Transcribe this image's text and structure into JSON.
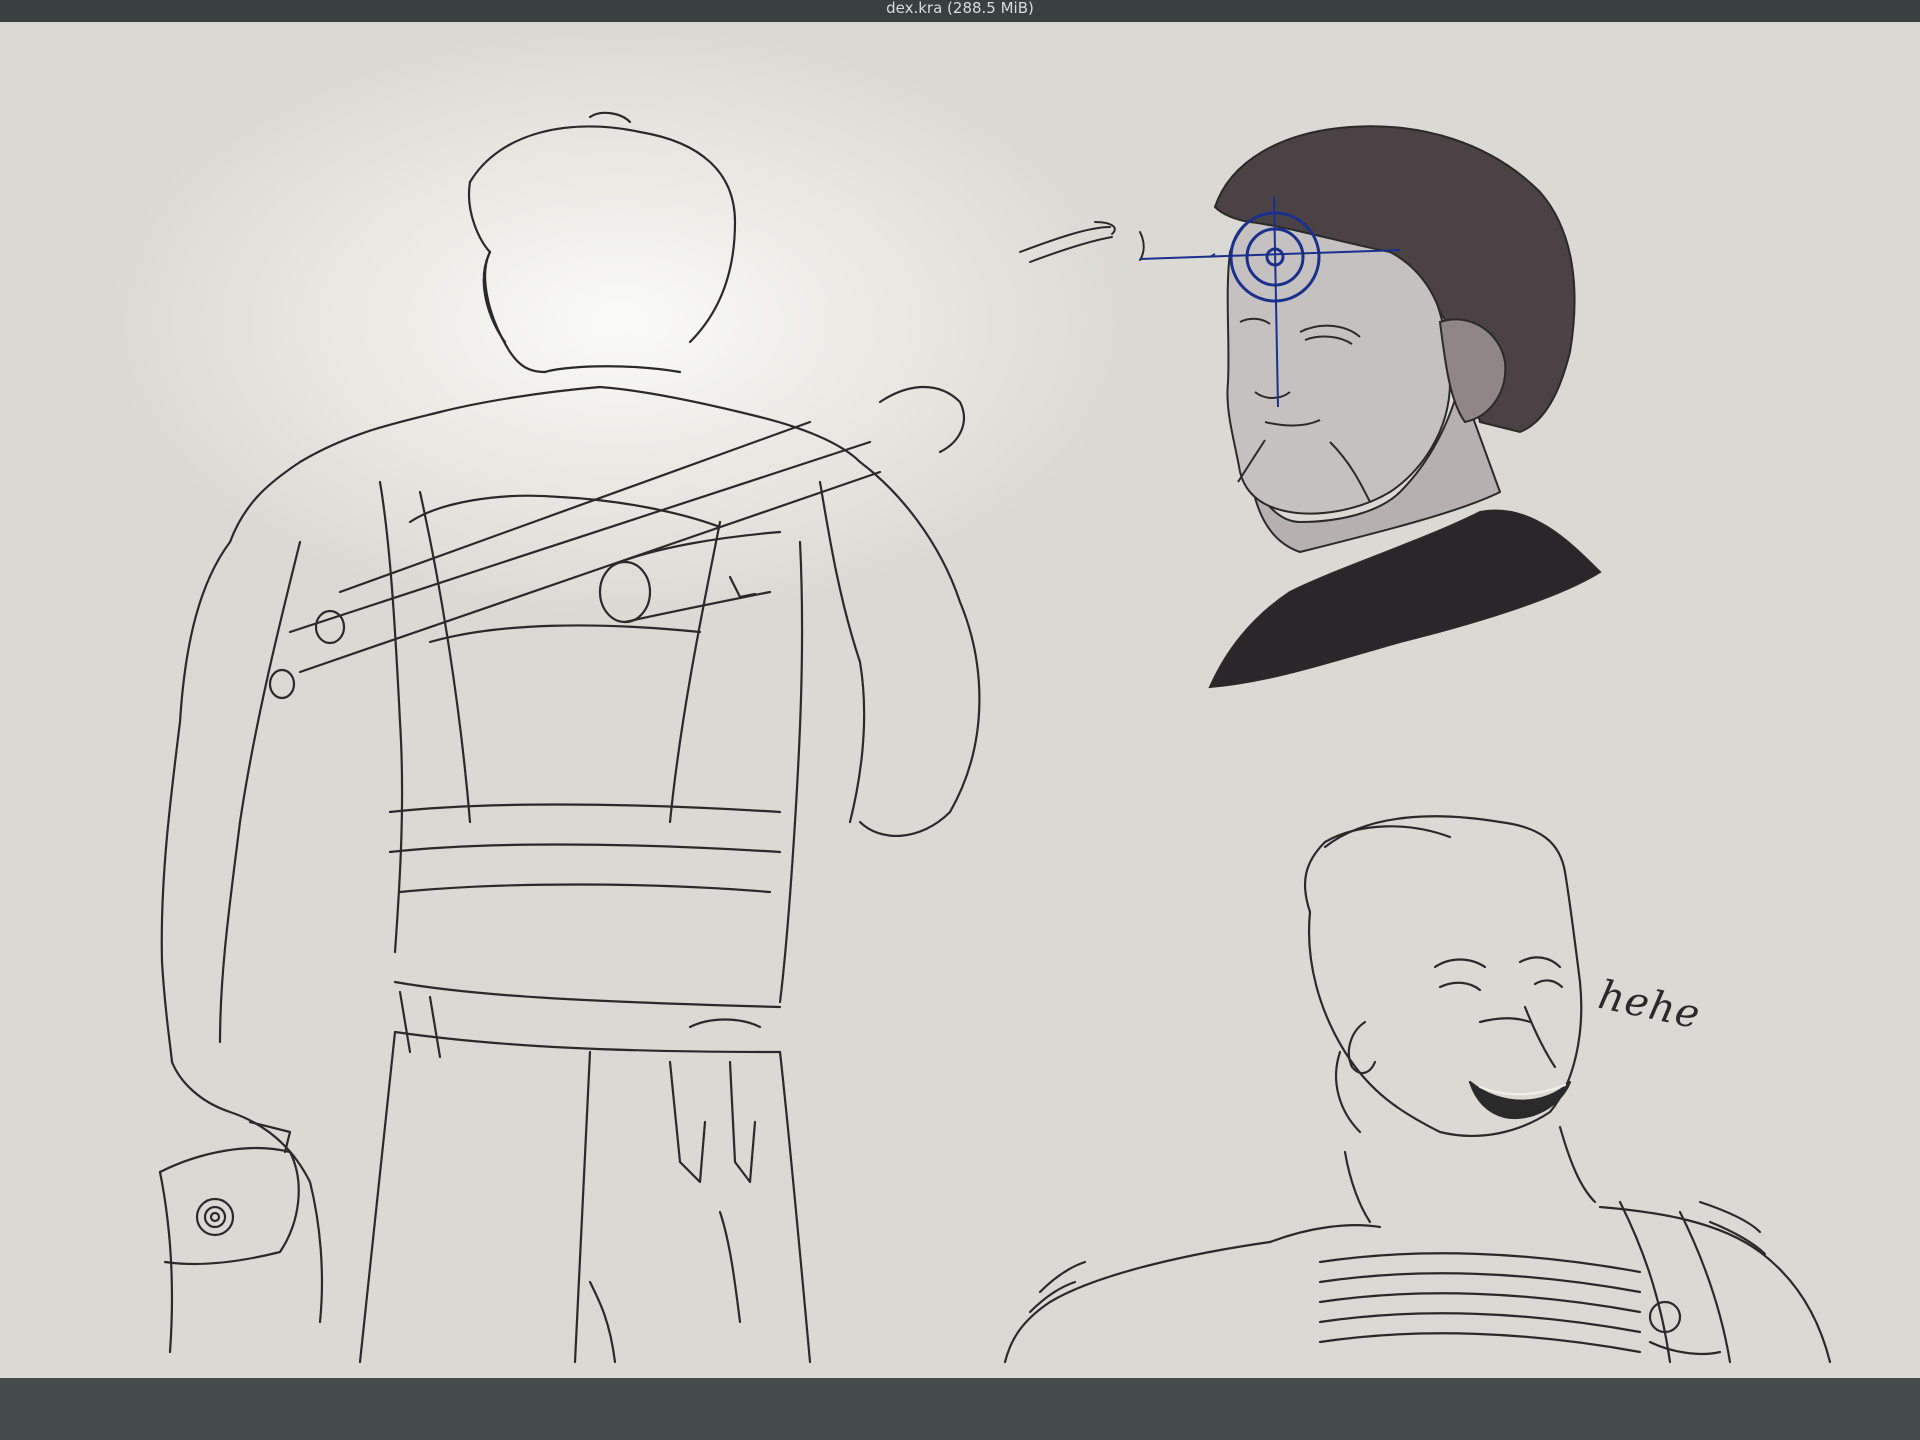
{
  "window": {
    "title": "dex.kra (288.5 MiB)"
  },
  "canvas": {
    "annotation_text": "hehe",
    "crosshair_color": "#1b2f8c",
    "line_color": "#2b2a2a",
    "paper_color": "#e6e5df"
  }
}
